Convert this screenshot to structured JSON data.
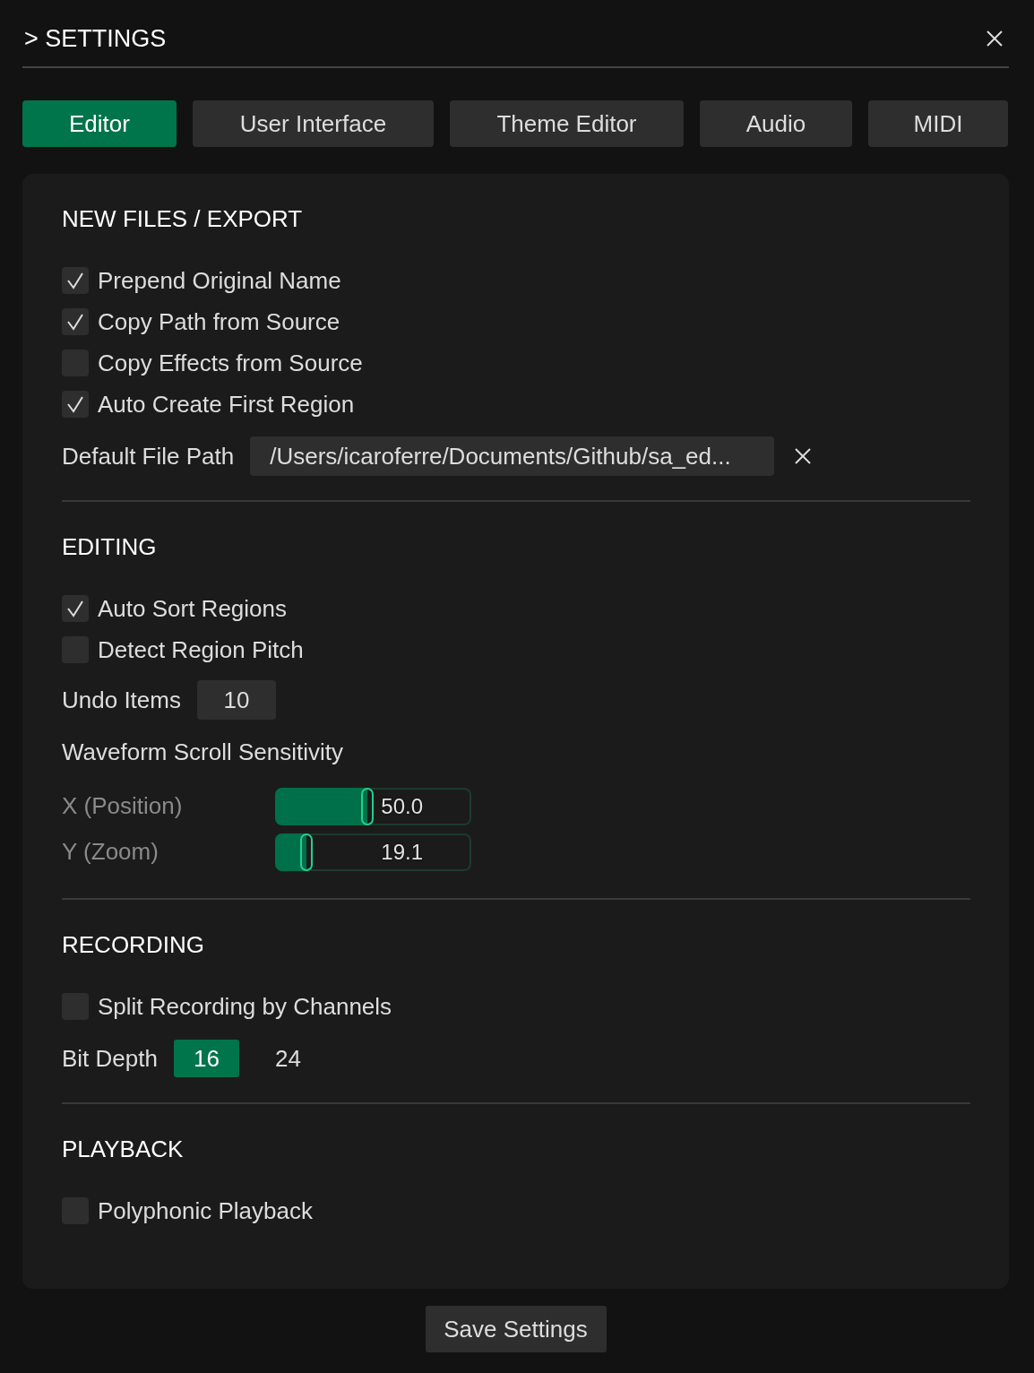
{
  "header": {
    "title": "> SETTINGS"
  },
  "tabs": [
    {
      "label": "Editor",
      "selected": true
    },
    {
      "label": "User Interface",
      "selected": false
    },
    {
      "label": "Theme Editor",
      "selected": false
    },
    {
      "label": "Audio",
      "selected": false
    },
    {
      "label": "MIDI",
      "selected": false
    }
  ],
  "sections": [
    {
      "title": "NEW FILES / EXPORT",
      "items": [
        {
          "kind": "checkbox",
          "label": "Prepend Original Name",
          "checked": true
        },
        {
          "kind": "checkbox",
          "label": "Copy Path from Source",
          "checked": true
        },
        {
          "kind": "checkbox",
          "label": "Copy Effects from Source",
          "checked": false
        },
        {
          "kind": "checkbox",
          "label": "Auto Create First Region",
          "checked": true
        },
        {
          "kind": "path",
          "label": "Default File Path",
          "value": "/Users/icaroferre/Documents/Github/sa_ed..."
        }
      ]
    },
    {
      "title": "EDITING",
      "items": [
        {
          "kind": "checkbox",
          "label": "Auto Sort Regions",
          "checked": true
        },
        {
          "kind": "checkbox",
          "label": "Detect Region Pitch",
          "checked": false
        },
        {
          "kind": "number",
          "label": "Undo Items",
          "value": "10"
        },
        {
          "kind": "heading",
          "label": "Waveform Scroll Sensitivity"
        },
        {
          "kind": "slider",
          "label": "X (Position)",
          "value": "50.0",
          "level": 0.47
        },
        {
          "kind": "slider",
          "label": "Y (Zoom)",
          "value": "19.1",
          "level": 0.16
        }
      ]
    },
    {
      "title": "RECORDING",
      "items": [
        {
          "kind": "checkbox",
          "label": "Split Recording by Channels",
          "checked": false
        },
        {
          "kind": "choice",
          "label": "Bit Depth",
          "options": [
            {
              "label": "16",
              "selected": true
            },
            {
              "label": "24",
              "selected": false
            }
          ]
        }
      ]
    },
    {
      "title": "PLAYBACK",
      "items": [
        {
          "kind": "checkbox",
          "label": "Polyphonic Playback",
          "checked": false
        }
      ]
    }
  ],
  "save_button": "Save Settings"
}
